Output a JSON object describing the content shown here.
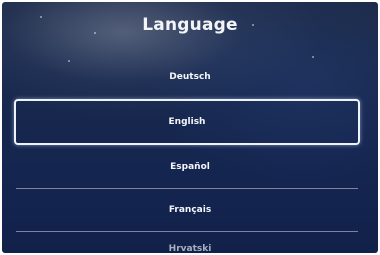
{
  "header": {
    "title": "Language"
  },
  "languages": {
    "items": [
      {
        "label": "Deutsch"
      },
      {
        "label": "English",
        "selected": true
      },
      {
        "label": "Español"
      },
      {
        "label": "Français"
      },
      {
        "label": "Hrvatski"
      }
    ]
  },
  "colors": {
    "background": "#18284d",
    "text": "#f4f6fa",
    "highlight_border": "#eef2fb"
  }
}
